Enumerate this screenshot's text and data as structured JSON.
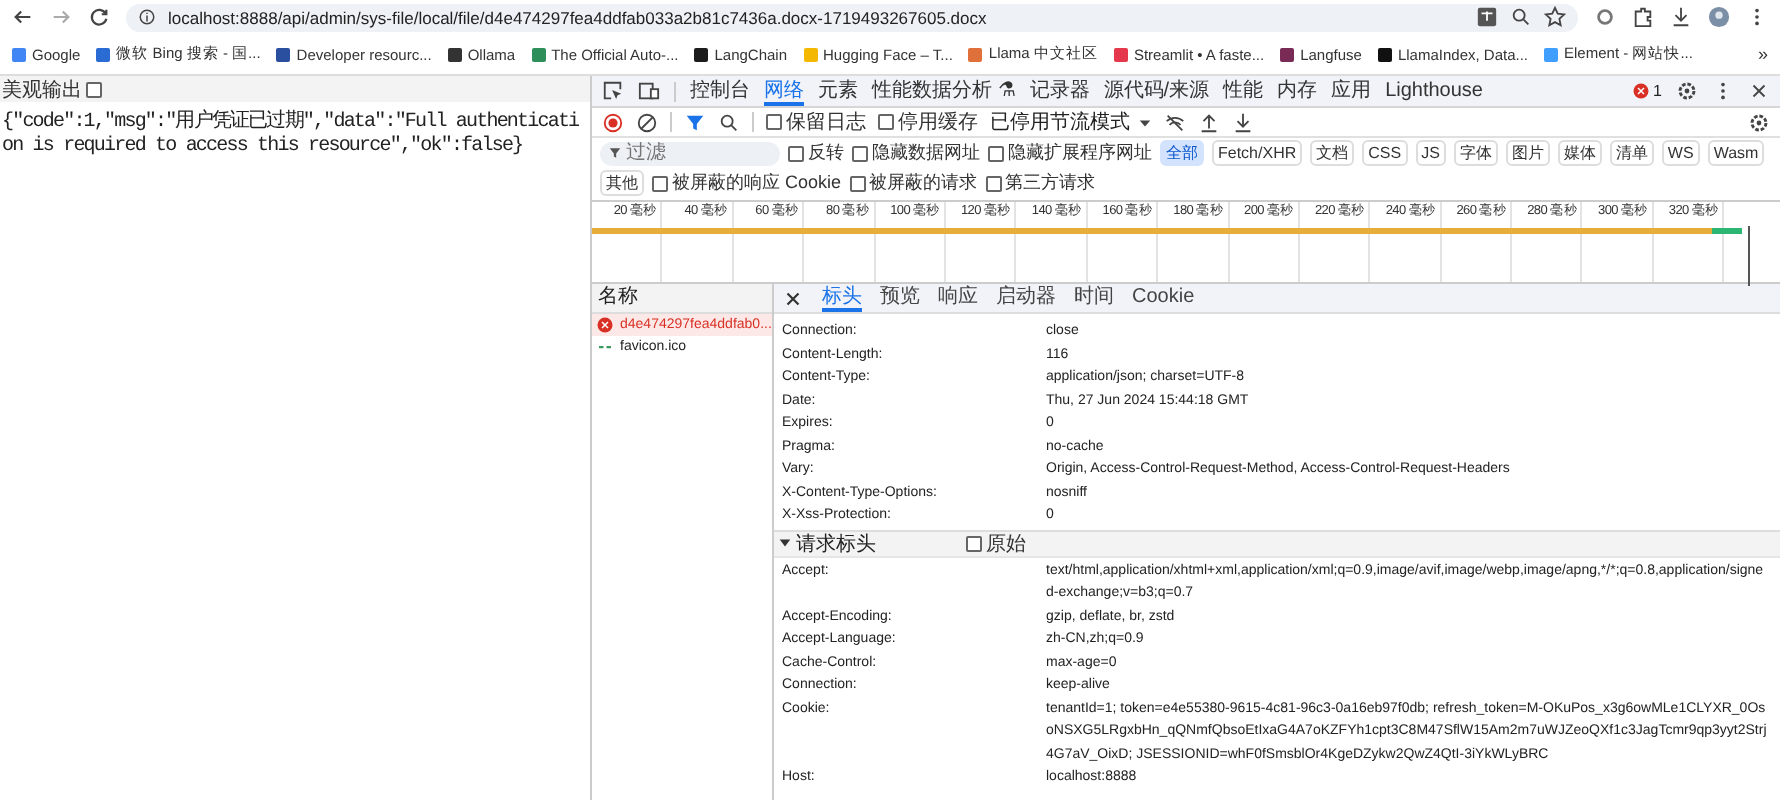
{
  "browser": {
    "url": "localhost:8888/api/admin/sys-file/local/file/d4e474297fea4ddfab033a2b81c7436a.docx-1719493267605.docx",
    "bookmarks": [
      {
        "label": "Google",
        "color": "#4285f4"
      },
      {
        "label": "微软 Bing 搜索 - 国...",
        "color": "#2b6cd4"
      },
      {
        "label": "Developer resourc...",
        "color": "#2a4f9e"
      },
      {
        "label": "Ollama",
        "color": "#333333"
      },
      {
        "label": "The Official Auto-...",
        "color": "#2f8f5b"
      },
      {
        "label": "LangChain",
        "color": "#1c1c1c"
      },
      {
        "label": "Hugging Face – T...",
        "color": "#f5b800"
      },
      {
        "label": "Llama 中文社区",
        "color": "#e0703a"
      },
      {
        "label": "Streamlit • A faste...",
        "color": "#e5384d"
      },
      {
        "label": "Langfuse",
        "color": "#7a2b55"
      },
      {
        "label": "LlamaIndex, Data...",
        "color": "#111111"
      },
      {
        "label": "Element - 网站快...",
        "color": "#409eff"
      }
    ],
    "more": "»"
  },
  "page": {
    "pretty_print": {
      "label": "美观输出",
      "checked": false
    },
    "body": "{\"code\":1,\"msg\":\"用户凭证已过期\",\"data\":\"Full authentication is required to access this resource\",\"ok\":false}"
  },
  "devtools": {
    "tabs": [
      {
        "label": "控制台",
        "selected": false
      },
      {
        "label": "网络",
        "selected": true
      },
      {
        "label": "元素",
        "selected": false
      },
      {
        "label": "性能数据分析 ⚗",
        "selected": false
      },
      {
        "label": "记录器",
        "selected": false
      },
      {
        "label": "源代码/来源",
        "selected": false
      },
      {
        "label": "性能",
        "selected": false
      },
      {
        "label": "内存",
        "selected": false
      },
      {
        "label": "应用",
        "selected": false
      },
      {
        "label": "Lighthouse",
        "selected": false
      }
    ],
    "error_count": "1",
    "toolbar": {
      "checkboxes": [
        {
          "label": "保留日志",
          "checked": false
        },
        {
          "label": "停用缓存",
          "checked": false
        }
      ],
      "throttle": "已停用节流模式"
    },
    "filter": {
      "placeholder": "过滤",
      "checkboxes": [
        {
          "label": "反转",
          "checked": false
        },
        {
          "label": "隐藏数据网址",
          "checked": false
        },
        {
          "label": "隐藏扩展程序网址",
          "checked": false
        }
      ],
      "types": [
        {
          "label": "全部",
          "selected": true
        },
        {
          "label": "Fetch/XHR",
          "selected": false
        },
        {
          "label": "文档",
          "selected": false
        },
        {
          "label": "CSS",
          "selected": false
        },
        {
          "label": "JS",
          "selected": false
        },
        {
          "label": "字体",
          "selected": false
        },
        {
          "label": "图片",
          "selected": false
        },
        {
          "label": "媒体",
          "selected": false
        },
        {
          "label": "清单",
          "selected": false
        },
        {
          "label": "WS",
          "selected": false
        },
        {
          "label": "Wasm",
          "selected": false
        },
        {
          "label": "其他",
          "selected": false
        }
      ],
      "after": [
        {
          "label": "被屏蔽的响应 Cookie",
          "checked": false
        }
      ],
      "second_row": [
        {
          "label": "被屏蔽的请求",
          "checked": false
        },
        {
          "label": "第三方请求",
          "checked": false
        }
      ]
    },
    "timeline_ticks": [
      "20 毫秒",
      "40 毫秒",
      "60 毫秒",
      "80 毫秒",
      "100 毫秒",
      "120 毫秒",
      "140 毫秒",
      "160 毫秒",
      "180 毫秒",
      "200 毫秒",
      "220 毫秒",
      "240 毫秒",
      "260 毫秒",
      "280 毫秒",
      "300 毫秒",
      "320 毫秒"
    ],
    "requests": {
      "header": "名称",
      "items": [
        {
          "name": "d4e474297fea4ddfab0...",
          "kind": "error",
          "selected": true
        },
        {
          "name": "favicon.ico",
          "kind": "normal",
          "selected": false
        }
      ]
    },
    "detail_tabs": [
      {
        "label": "标头",
        "selected": true
      },
      {
        "label": "预览",
        "selected": false
      },
      {
        "label": "响应",
        "selected": false
      },
      {
        "label": "启动器",
        "selected": false
      },
      {
        "label": "时间",
        "selected": false
      },
      {
        "label": "Cookie",
        "selected": false
      }
    ],
    "response_headers": [
      {
        "name": "Connection:",
        "value": "close"
      },
      {
        "name": "Content-Length:",
        "value": "116"
      },
      {
        "name": "Content-Type:",
        "value": "application/json; charset=UTF-8"
      },
      {
        "name": "Date:",
        "value": "Thu, 27 Jun 2024 15:44:18 GMT"
      },
      {
        "name": "Expires:",
        "value": "0"
      },
      {
        "name": "Pragma:",
        "value": "no-cache"
      },
      {
        "name": "Vary:",
        "value": "Origin, Access-Control-Request-Method, Access-Control-Request-Headers"
      },
      {
        "name": "X-Content-Type-Options:",
        "value": "nosniff"
      },
      {
        "name": "X-Xss-Protection:",
        "value": "0"
      }
    ],
    "request_section": {
      "title": "请求标头",
      "expanded": true,
      "raw": {
        "label": "原始",
        "checked": false
      }
    },
    "request_headers": [
      {
        "name": "Accept:",
        "value": "text/html,application/xhtml+xml,application/xml;q=0.9,image/avif,image/webp,image/apng,*/*;q=0.8,application/signed-exchange;v=b3;q=0.7"
      },
      {
        "name": "Accept-Encoding:",
        "value": "gzip, deflate, br, zstd"
      },
      {
        "name": "Accept-Language:",
        "value": "zh-CN,zh;q=0.9"
      },
      {
        "name": "Cache-Control:",
        "value": "max-age=0"
      },
      {
        "name": "Connection:",
        "value": "keep-alive"
      },
      {
        "name": "Cookie:",
        "value": "tenantId=1; token=e4e55380-9615-4c81-96c3-0a16eb97f0db; refresh_token=M-OKuPos_x3g6owMLe1CLYXR_0OsoNSXG5LRgxbHn_qQNmfQbsoEtIxaG4A7oKZFYh1cpt3C8M47SflW15Am2m7uWJZeoQXf1c3JagTcmr9qp3yyt2Strj4G7aV_OixD; JSESSIONID=whF0fSmsblOr4KgeDZykw2QwZ4QtI-3iYkWLyBRC"
      },
      {
        "name": "Host:",
        "value": "localhost:8888"
      }
    ]
  }
}
